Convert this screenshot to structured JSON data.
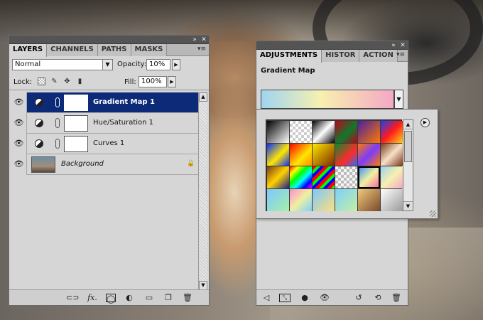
{
  "layers_panel": {
    "tabs": [
      {
        "label": "LAYERS",
        "active": true
      },
      {
        "label": "CHANNELS",
        "active": false
      },
      {
        "label": "PATHS",
        "active": false
      },
      {
        "label": "MASKS",
        "active": false
      }
    ],
    "blend_mode": "Normal",
    "opacity_label": "Opacity:",
    "opacity_value": "10%",
    "lock_label": "Lock:",
    "fill_label": "Fill:",
    "fill_value": "100%",
    "layers": [
      {
        "name": "Gradient Map 1",
        "selected": true,
        "kind": "adjustment"
      },
      {
        "name": "Hue/Saturation 1",
        "selected": false,
        "kind": "adjustment"
      },
      {
        "name": "Curves 1",
        "selected": false,
        "kind": "adjustment"
      },
      {
        "name": "Background",
        "selected": false,
        "kind": "background",
        "locked": true
      }
    ],
    "footer_icons": [
      "link-layers-icon",
      "fx-icon",
      "add-mask-icon",
      "new-adjustment-icon",
      "new-group-icon",
      "new-layer-icon",
      "delete-layer-icon"
    ]
  },
  "adjustments_panel": {
    "tabs": [
      {
        "label": "ADJUSTMENTS",
        "active": true
      },
      {
        "label": "HISTOR",
        "active": false
      },
      {
        "label": "ACTION",
        "active": false
      }
    ],
    "title": "Gradient Map",
    "footer_icons": [
      "return-to-list-icon",
      "expand-view-icon",
      "clip-to-layer-icon",
      "toggle-visibility-icon",
      "view-previous-icon",
      "reset-icon",
      "delete-adjustment-icon"
    ]
  },
  "gradient_picker": {
    "swatches": [
      "linear-gradient(135deg,#000 0%,#fff 100%)",
      "repeating-conic-gradient(#ccc 0 25%,#fff 0 50%) 0 0/8px 8px",
      "linear-gradient(135deg,#000 0%,#fff 50%,#000 100%)",
      "linear-gradient(135deg,#c2001a 0%,#0c7a2c 55%,#c2001a 100%)",
      "linear-gradient(135deg,#4a1fa0 0%,#ff7a00 100%)",
      "linear-gradient(135deg,#1a3cff 0%,#ff1a1a 50%,#ffd21a 100%)",
      "linear-gradient(135deg,#0a2cff 0%,#ffe600 55%,#0a2cff 100%)",
      "linear-gradient(135deg,#ff0000 0%,#ffe600 60%,#ff8a00 100%)",
      "linear-gradient(135deg,#ffe600 0%,#7a2a00 100%)",
      "linear-gradient(135deg,#0a8a2a 0%,#ff2a2a 60%,#2a6cff 100%)",
      "linear-gradient(135deg,#ff7a00 0%,#7a3cff 50%,#ff7a00 100%)",
      "linear-gradient(135deg,#7a3a1a 0%,#f7e0c8 50%,#7a3a1a 100%)",
      "linear-gradient(135deg,#7a3a1a 0%,#ffd200 50%,#1a1a8a 100%)",
      "linear-gradient(135deg,#ff0000,#ffff00,#00ff00,#00ffff,#0000ff,#ff00ff)",
      "repeating-linear-gradient(135deg,#ff0000 0 4px,#00ff00 4px 8px,#0000ff 8px 12px)",
      "repeating-conic-gradient(#bbb 0 25%,#f4f4f4 0 50%) 0 0/8px 8px",
      "linear-gradient(135deg,#2a8aff 0%,#f0f0a0 50%,#ff5aa0 100%)",
      "linear-gradient(135deg,#9ad0f0 0%,#f7f0b0 50%,#f0a8c4 100%)",
      "linear-gradient(135deg,#7ac8ff 0%,#a8f0a8 100%)",
      "linear-gradient(135deg,#ff8ad0 0%,#f0f0a0 50%,#7ad0ff 100%)",
      "linear-gradient(135deg,#7ac8ff 0%,#ffe07a 100%)",
      "linear-gradient(135deg,#7ad0ff 0%,#c8f0a0 100%)",
      "linear-gradient(135deg,#f0c87a 0%,#7a4a2a 100%)",
      "linear-gradient(135deg,#ffffff 0%,#9a9a9a 100%)"
    ],
    "selected_index": 16
  }
}
